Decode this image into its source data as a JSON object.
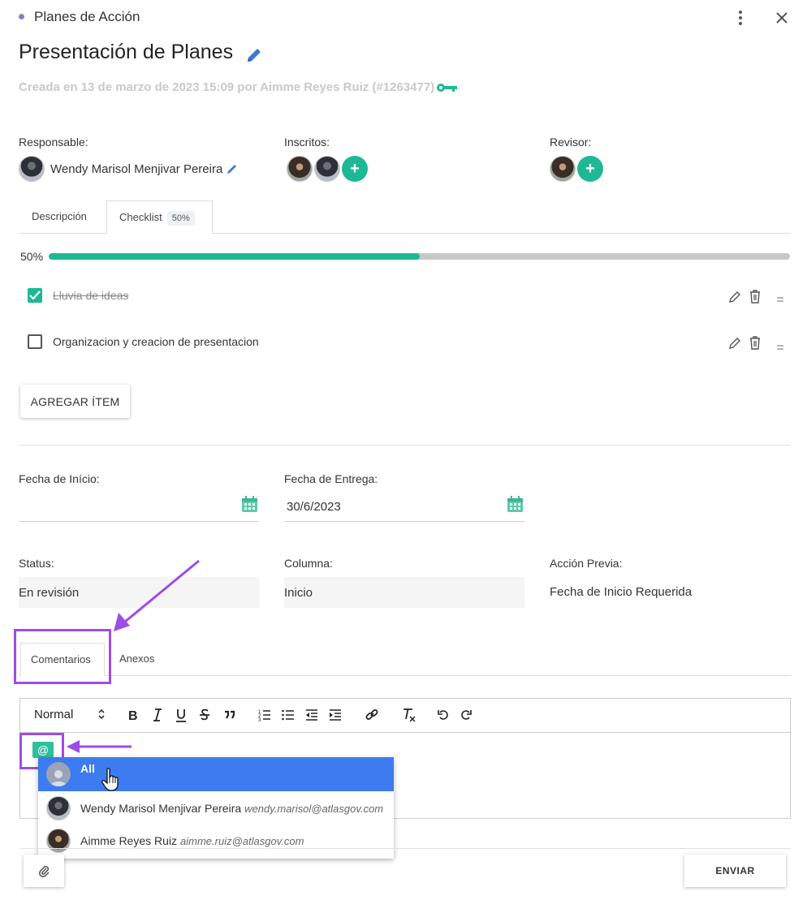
{
  "header": {
    "module": "Planes de Acción",
    "title": "Presentación de Planes",
    "created": "Creada en 13 de marzo de 2023 15:09 por Aimme Reyes Ruiz (#1263477)"
  },
  "people": {
    "responsable_label": "Responsable:",
    "responsable_name": "Wendy Marisol Menjivar Pereira",
    "inscritos_label": "Inscritos:",
    "revisor_label": "Revisor:"
  },
  "tabs": [
    {
      "label": "Descripción"
    },
    {
      "label": "Checklist",
      "badge": "50%"
    }
  ],
  "checklist": {
    "progress_label": "50%",
    "progress_value": 0.5,
    "items": [
      {
        "text": "Lluvia de ideas",
        "done": true
      },
      {
        "text": "Organizacion y creacion de presentacion",
        "done": false
      }
    ],
    "add_label": "AGREGAR ÍTEM"
  },
  "dates": {
    "start_label": "Fecha de Início:",
    "start_value": "",
    "due_label": "Fecha de Entrega:",
    "due_value": "30/6/2023"
  },
  "meta": {
    "status_label": "Status:",
    "status_value": "En revisión",
    "column_label": "Columna:",
    "column_value": "Inicio",
    "prev_label": "Acción Previa:",
    "prev_value": "Fecha de Inicio Requerida"
  },
  "bottom_tabs": [
    {
      "label": "Comentarios"
    },
    {
      "label": "Anexos"
    }
  ],
  "editor": {
    "format_select": "Normal",
    "mention_chip": "@"
  },
  "mentions": [
    {
      "name": "All",
      "email": ""
    },
    {
      "name": "Wendy Marisol Menjivar Pereira",
      "email": "wendy.marisol@atlasgov.com"
    },
    {
      "name": "Aimme Reyes Ruiz",
      "email": "aimme.ruiz@atlasgov.com"
    }
  ],
  "actions": {
    "send_label": "ENVIAR"
  },
  "colors": {
    "accent": "#1fb894",
    "highlight": "#9e4ce6",
    "dropdown_active": "#3d7bf0"
  }
}
